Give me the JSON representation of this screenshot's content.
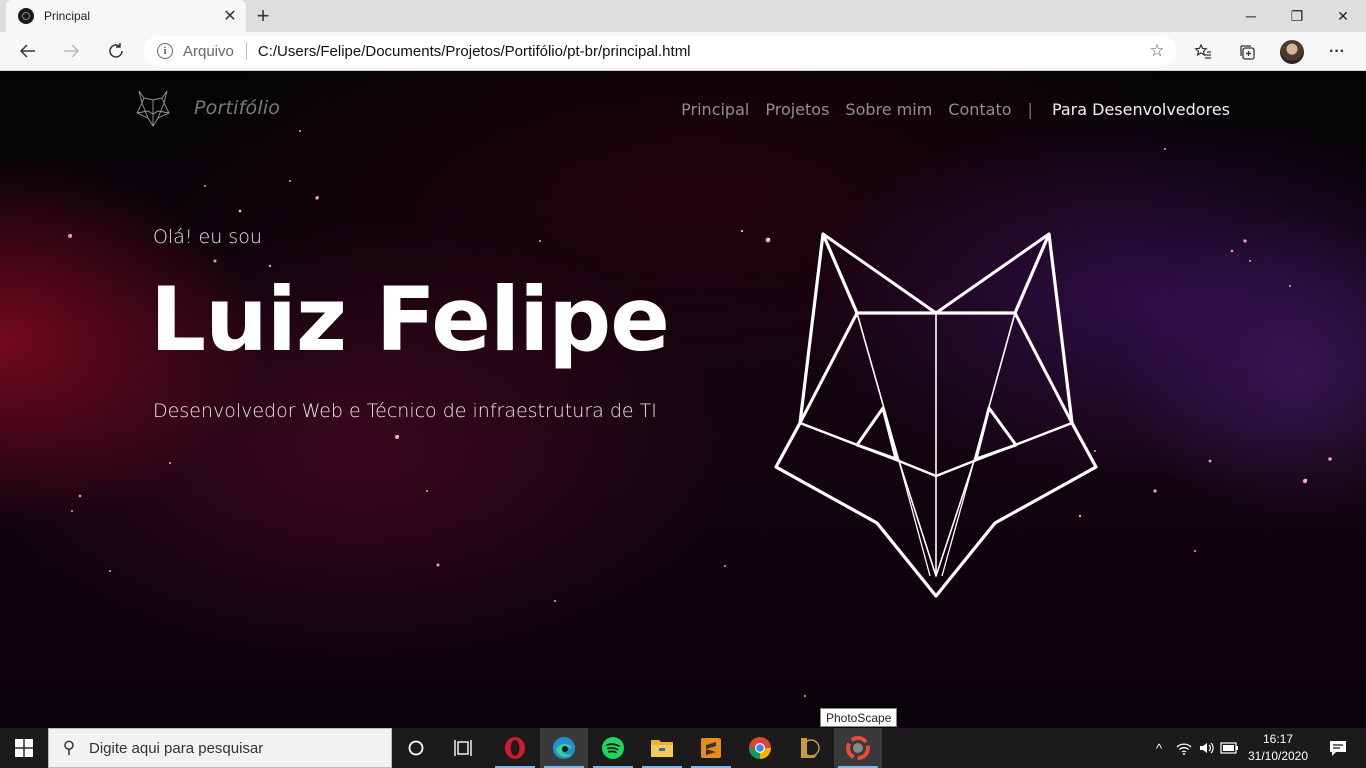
{
  "browser": {
    "tab_title": "Principal",
    "tab_close": "✕",
    "new_tab": "+",
    "window_controls": {
      "minimize": "─",
      "restore": "❐",
      "close": "✕"
    },
    "address": {
      "scheme_label": "Arquivo",
      "url": "C:/Users/Felipe/Documents/Projetos/Portifólio/pt-br/principal.html",
      "favorite_icon": "star-icon"
    },
    "more_label": "···"
  },
  "site": {
    "logo_text": "Portifólio",
    "nav": [
      "Principal",
      "Projetos",
      "Sobre mim",
      "Contato"
    ],
    "nav_divider": "|",
    "nav_dev": "Para Desenvolvedores",
    "hero": {
      "greeting": "Olá! eu sou",
      "name": "Luiz Felipe",
      "role": "Desenvolvedor Web e Técnico de infraestrutura de TI"
    },
    "colors": {
      "accent": "#ffffff",
      "nav_text": "#8f8f8f",
      "background": "#0a0309"
    }
  },
  "tooltip": "PhotoScape",
  "taskbar": {
    "search_placeholder": "Digite aqui para pesquisar",
    "apps": [
      "cortana-icon",
      "task-view-icon",
      "opera-icon",
      "edge-icon",
      "spotify-icon",
      "file-explorer-icon",
      "sublime-text-icon",
      "chrome-icon",
      "league-of-legends-icon",
      "photoscape-icon"
    ],
    "time": "16:17",
    "date": "31/10/2020"
  }
}
